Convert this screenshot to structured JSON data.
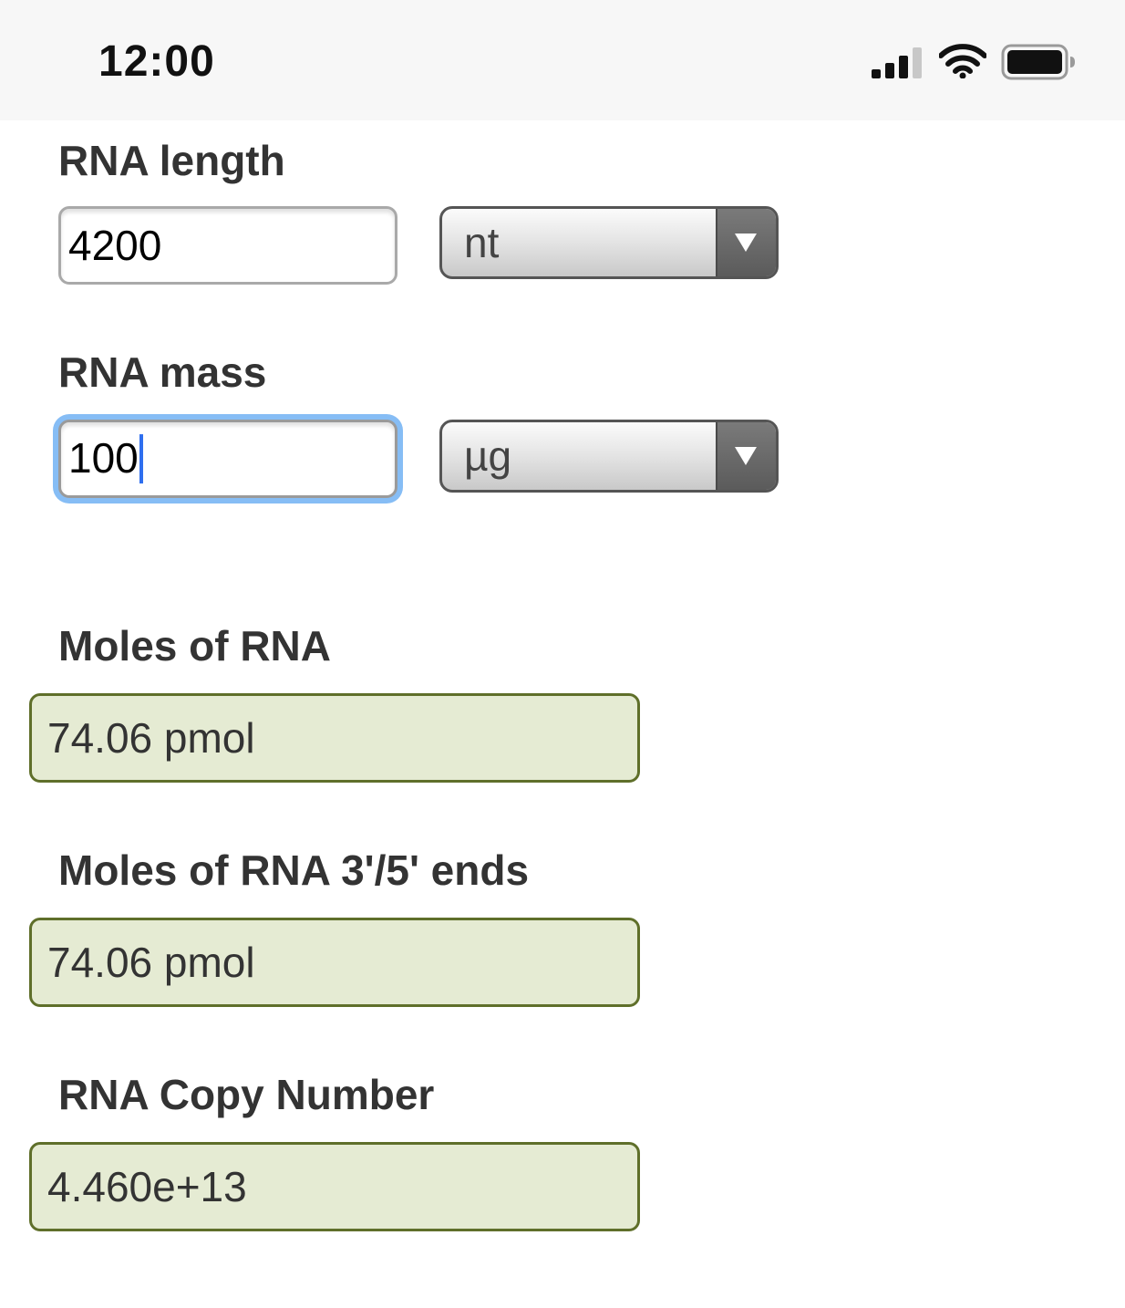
{
  "status_bar": {
    "time": "12:00",
    "icons": [
      "cellular-signal-icon",
      "wifi-icon",
      "battery-icon"
    ]
  },
  "form": {
    "rna_length": {
      "label": "RNA length",
      "value": "4200",
      "unit": "nt"
    },
    "rna_mass": {
      "label": "RNA mass",
      "value": "100",
      "unit": "µg"
    }
  },
  "results": {
    "moles": {
      "label": "Moles of RNA",
      "value": "74.06 pmol"
    },
    "moles_ends": {
      "label": "Moles of RNA 3'/5' ends",
      "value": "74.06 pmol"
    },
    "copy_number": {
      "label": "RNA Copy Number",
      "value": "4.460e+13"
    }
  },
  "colors": {
    "result_background": "#e5ebd3",
    "result_border": "#5f6f2a",
    "focus_ring": "#86bdf5",
    "caret": "#2f6fef"
  }
}
